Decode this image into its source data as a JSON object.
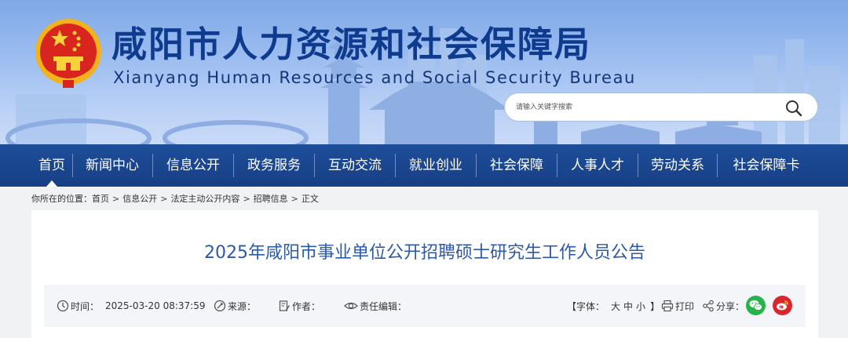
{
  "site": {
    "title_cn": "咸阳市人力资源和社会保障局",
    "title_en": "Xianyang Human Resources and Social Security Bureau",
    "emblem_icon": "national-emblem-icon"
  },
  "search": {
    "placeholder": "请输入关键字搜索",
    "button_icon": "search-icon"
  },
  "nav": {
    "active_index": 0,
    "items": [
      {
        "label": "首页"
      },
      {
        "label": "新闻中心"
      },
      {
        "label": "信息公开"
      },
      {
        "label": "政务服务"
      },
      {
        "label": "互动交流"
      },
      {
        "label": "就业创业"
      },
      {
        "label": "社会保障"
      },
      {
        "label": "人事人才"
      },
      {
        "label": "劳动关系"
      },
      {
        "label": "社会保障卡"
      }
    ]
  },
  "breadcrumb": {
    "prefix": "你所在的位置：",
    "items": [
      "首页",
      "信息公开",
      "法定主动公开内容",
      "招聘信息",
      "正文"
    ],
    "separator": ">"
  },
  "article": {
    "title": "2025年咸阳市事业单位公开招聘硕士研究生工作人员公告",
    "meta": {
      "time_label": "时间：",
      "time_value": "2025-03-20 08:37:59",
      "source_label": "来源：",
      "author_label": "作者：",
      "editor_label": "责任编辑：",
      "font_size_label": "【字体：",
      "font_large": "大",
      "font_medium": "中",
      "font_small": "小",
      "font_size_close": "】",
      "print_label": "打印",
      "share_label": "分享："
    },
    "share": {
      "wechat_color": "#28b24b",
      "weibo_color": "#d8262c"
    }
  },
  "colors": {
    "nav_bg": "#1a4690",
    "title_text": "#2b5aa8",
    "brand_text": "#0f3b8f"
  }
}
